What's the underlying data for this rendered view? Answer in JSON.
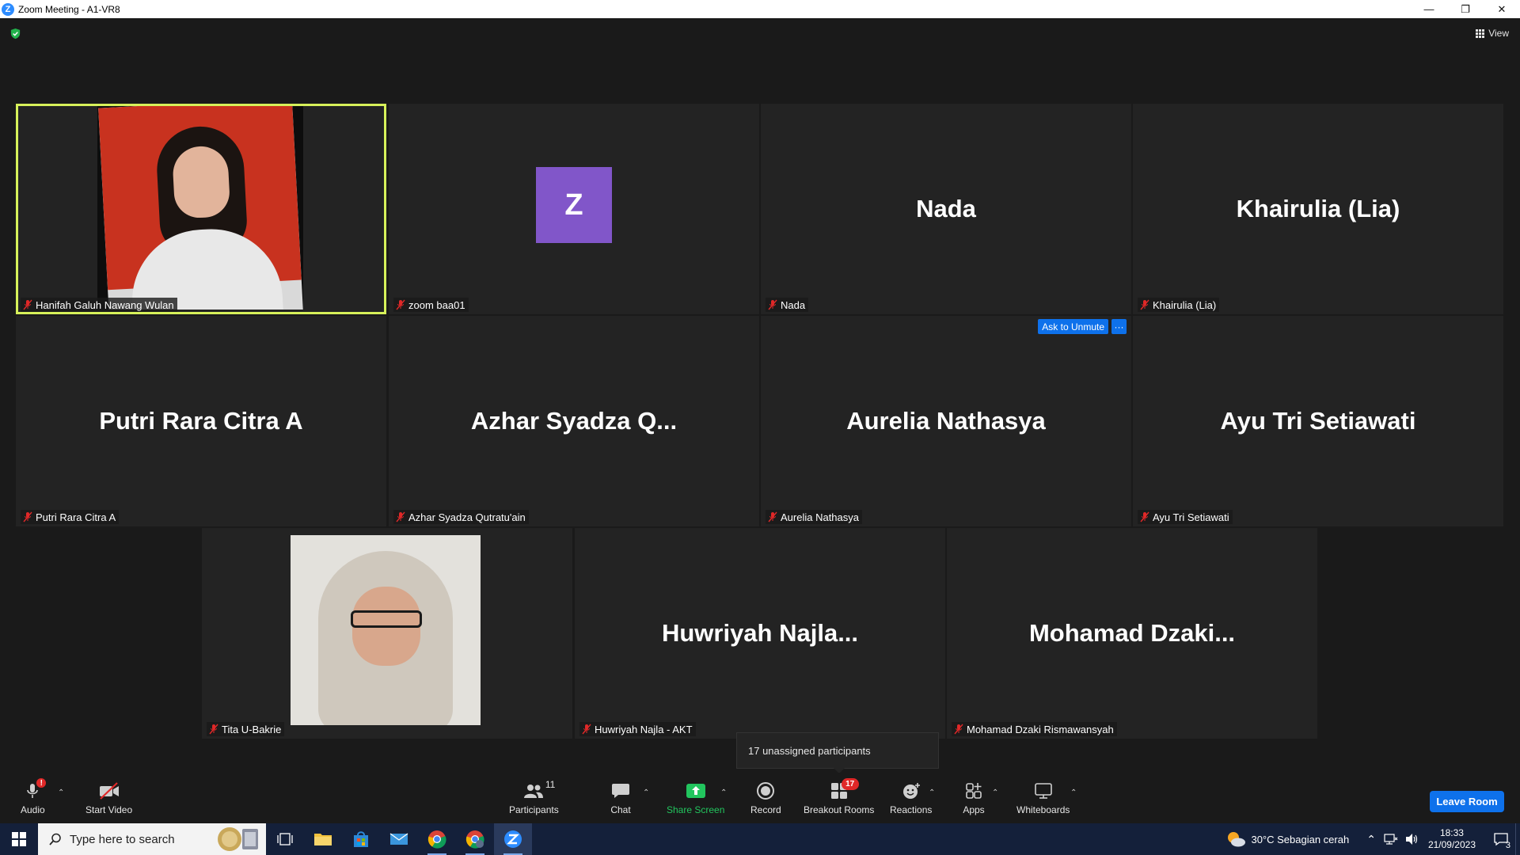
{
  "window": {
    "title": "Zoom Meeting - A1-VR8",
    "app_logo": "Z",
    "view_label": "View"
  },
  "tiles": [
    {
      "name": "Hanifah Galuh Nawang Wulan",
      "big": "",
      "type": "video"
    },
    {
      "name": "zoom baa01",
      "big": "Z",
      "type": "avatar"
    },
    {
      "name": "Nada",
      "big": "Nada",
      "type": "name"
    },
    {
      "name": "Khairulia (Lia)",
      "big": "Khairulia (Lia)",
      "type": "name"
    },
    {
      "name": "Putri Rara Citra A",
      "big": "Putri Rara Citra A",
      "type": "name"
    },
    {
      "name": "Azhar Syadza Qutratu'ain",
      "big": "Azhar  Syadza  Q...",
      "type": "name"
    },
    {
      "name": "Aurelia Nathasya",
      "big": "Aurelia Nathasya",
      "type": "name"
    },
    {
      "name": "Ayu Tri Setiawati",
      "big": "Ayu Tri Setiawati",
      "type": "name"
    },
    {
      "name": "Tita U-Bakrie",
      "big": "",
      "type": "video"
    },
    {
      "name": "Huwriyah Najla - AKT",
      "big": "Huwriyah  Najla...",
      "type": "name"
    },
    {
      "name": "Mohamad Dzaki Rismawansyah",
      "big": "Mohamad  Dzaki...",
      "type": "name"
    }
  ],
  "hover_actions": {
    "ask_to_unmute": "Ask to Unmute",
    "more": "···"
  },
  "tooltip": "17 unassigned participants",
  "toolbar": {
    "audio": "Audio",
    "start_video": "Start Video",
    "participants": "Participants",
    "participants_count": "11",
    "chat": "Chat",
    "share_screen": "Share Screen",
    "record": "Record",
    "breakout_rooms": "Breakout Rooms",
    "breakout_badge": "17",
    "reactions": "Reactions",
    "apps": "Apps",
    "whiteboards": "Whiteboards",
    "leave": "Leave Room",
    "audio_alert": "!"
  },
  "taskbar": {
    "search_placeholder": "Type here to search",
    "weather": "30°C  Sebagian cerah",
    "time": "18:33",
    "date": "21/09/2023",
    "notifications": "3"
  },
  "colors": {
    "accent_blue": "#0e71eb",
    "active_speaker": "#d7f15a",
    "share_green": "#22c55e",
    "avatar_purple": "#8156c9",
    "mute_red": "#e02828"
  }
}
